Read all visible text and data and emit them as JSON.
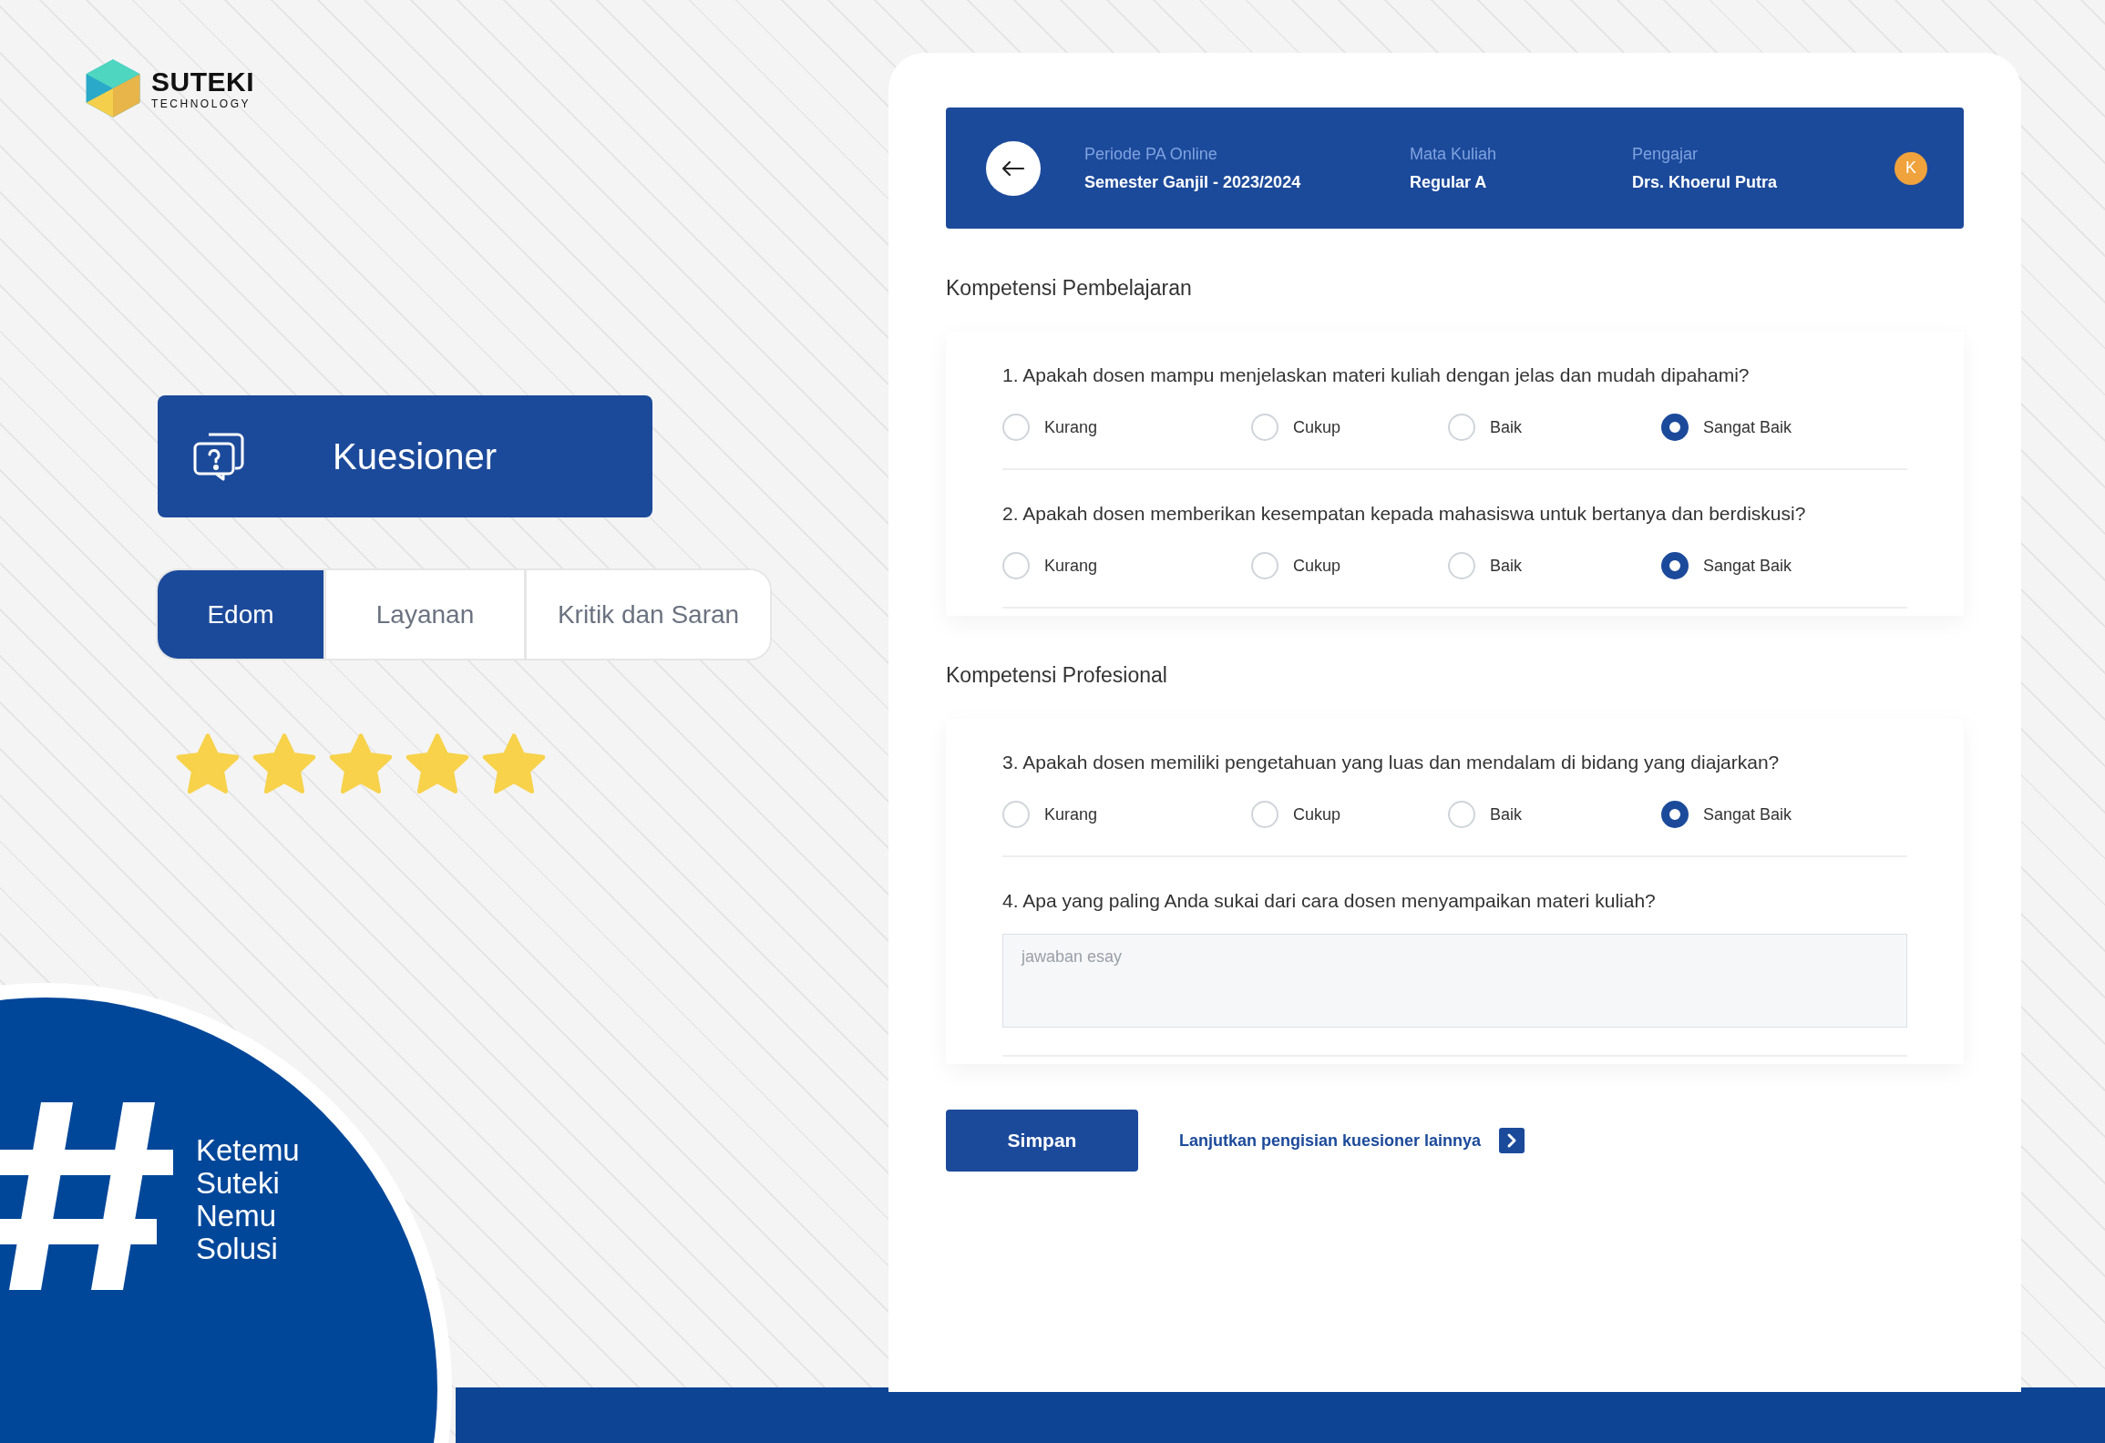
{
  "brand": {
    "name": "SUTEKI",
    "sub": "TECHNOLOGY"
  },
  "menu_card": {
    "title": "Kuesioner"
  },
  "tabs": [
    {
      "label": "Edom",
      "selected": true
    },
    {
      "label": "Layanan",
      "selected": false
    },
    {
      "label": "Kritik dan Saran",
      "selected": false
    }
  ],
  "rating": {
    "stars": 5
  },
  "tagline": {
    "lines": [
      "Ketemu",
      "Suteki",
      "Nemu",
      "Solusi"
    ]
  },
  "header": {
    "fields": [
      {
        "label": "Periode PA Online",
        "value": "Semester Ganjil - 2023/2024"
      },
      {
        "label": "Mata Kuliah",
        "value": "Regular A"
      },
      {
        "label": "Pengajar",
        "value": "Drs. Khoerul Putra"
      }
    ],
    "avatar": "K"
  },
  "sections": [
    {
      "title": "Kompetensi Pembelajaran",
      "questions": [
        {
          "kind": "choice",
          "text": "1. Apakah dosen mampu menjelaskan materi kuliah dengan jelas dan mudah dipahami?",
          "options": [
            {
              "label": "Kurang",
              "selected": false
            },
            {
              "label": "Cukup",
              "selected": false
            },
            {
              "label": "Baik",
              "selected": false
            },
            {
              "label": "Sangat Baik",
              "selected": true
            }
          ]
        },
        {
          "kind": "choice",
          "text": "2. Apakah dosen memberikan kesempatan kepada mahasiswa untuk bertanya dan berdiskusi?",
          "options": [
            {
              "label": "Kurang",
              "selected": false
            },
            {
              "label": "Cukup",
              "selected": false
            },
            {
              "label": "Baik",
              "selected": false
            },
            {
              "label": "Sangat Baik",
              "selected": true
            }
          ]
        }
      ]
    },
    {
      "title": "Kompetensi Profesional",
      "questions": [
        {
          "kind": "choice",
          "text": "3. Apakah dosen memiliki pengetahuan yang luas dan mendalam di bidang yang diajarkan?",
          "options": [
            {
              "label": "Kurang",
              "selected": false
            },
            {
              "label": "Cukup",
              "selected": false
            },
            {
              "label": "Baik",
              "selected": false
            },
            {
              "label": "Sangat Baik",
              "selected": true
            }
          ]
        },
        {
          "kind": "essay",
          "text": "4. Apa yang paling Anda sukai dari cara dosen menyampaikan materi kuliah?",
          "placeholder": "jawaban esay"
        }
      ]
    }
  ],
  "actions": {
    "save": "Simpan",
    "next_link": "Lanjutkan pengisian kuesioner lainnya"
  }
}
